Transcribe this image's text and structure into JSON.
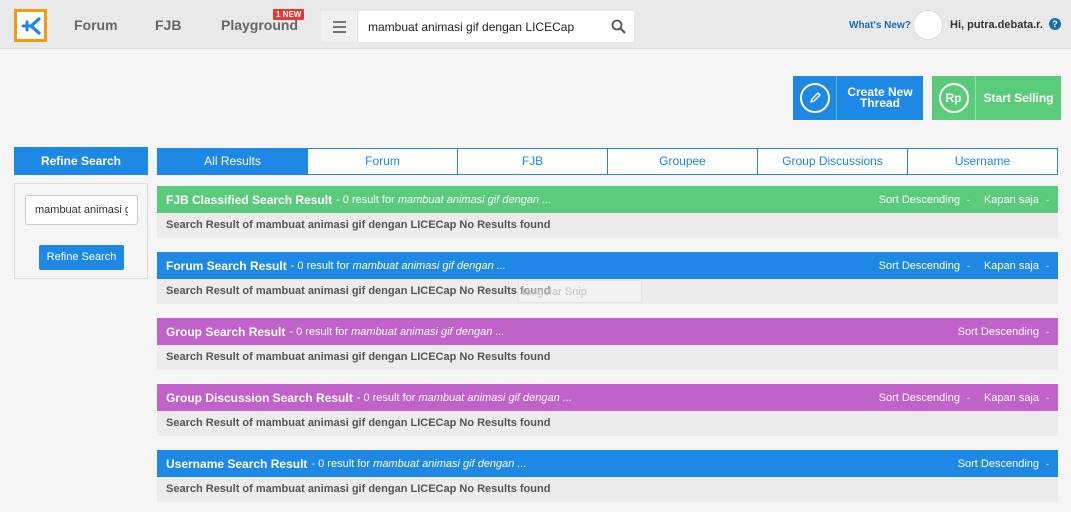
{
  "header": {
    "logo_icon": "kaskus-logo-icon",
    "nav": [
      "Forum",
      "FJB",
      "Playground"
    ],
    "new_badge": "1 NEW",
    "search_value": "mambuat animasi gif dengan LICECap",
    "whats_new": "What's New?",
    "user": "Hi, putra.debata.r.",
    "help": "?"
  },
  "actions": {
    "create_thread": "Create New Thread",
    "start_selling": "Start Selling",
    "sell_icon": "Rp"
  },
  "refine": {
    "title": "Refine Search",
    "input_value": "mambuat animasi gif dengan LICECap",
    "button": "Refine Search"
  },
  "tabs": [
    "All Results",
    "Forum",
    "FJB",
    "Groupee",
    "Group Discussions",
    "Username"
  ],
  "result_sub_prefix": "- 0 result for",
  "result_query": "mambuat animasi gif dengan ...",
  "sections": {
    "fjb": {
      "title": "FJB Classified Search Result",
      "color": "#5acb7b",
      "sort": "Sort Descending",
      "time": "Kapan saja"
    },
    "forum": {
      "title": "Forum Search Result",
      "color": "#1e88e5",
      "sort": "Sort Descending",
      "time": "Kapan saja"
    },
    "group": {
      "title": "Group Search Result",
      "color": "#c062c9",
      "sort": "Sort Descending"
    },
    "discussion": {
      "title": "Group Discussion Search Result",
      "color": "#c062c9",
      "sort": "Sort Descending",
      "time": "Kapan saja"
    },
    "username": {
      "title": "Username Search Result",
      "color": "#1e88e5",
      "sort": "Sort Descending"
    }
  },
  "no_results_text": "Search Result of mambuat animasi gif dengan LICECap No Results found",
  "caret": "-",
  "ghost_text": "tangular Snip"
}
